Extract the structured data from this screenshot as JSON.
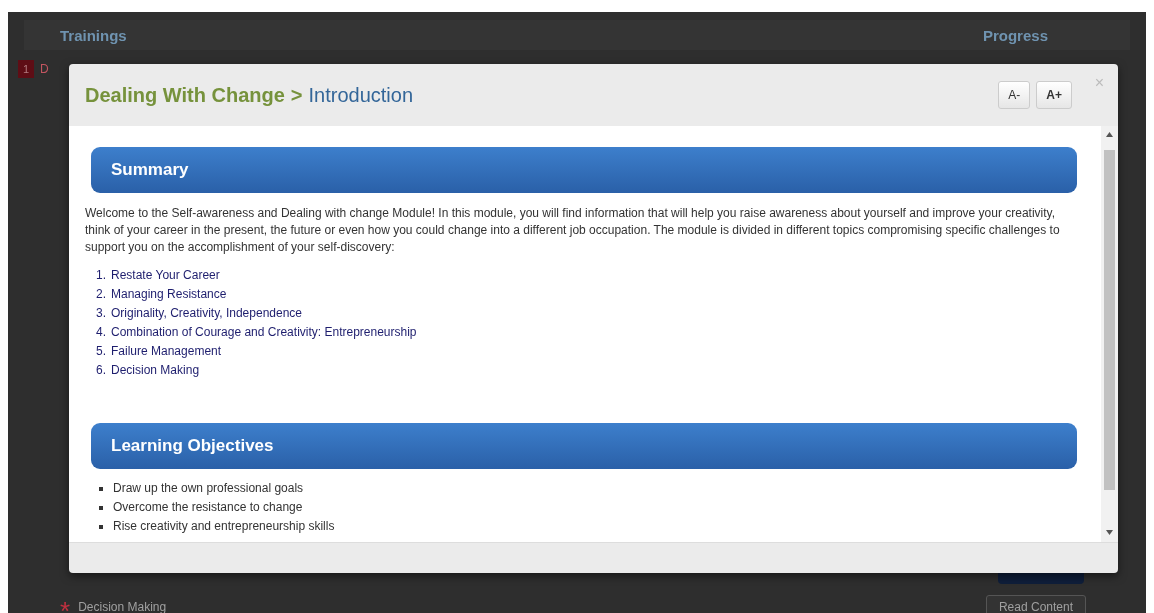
{
  "background_page": {
    "columns": [
      "Trainings",
      "Progress"
    ],
    "badge": "1",
    "first_row_text": "D",
    "last_row": {
      "marker": "*",
      "label": "Decision Making",
      "button": "Read Content"
    }
  },
  "modal": {
    "title": "Dealing With Change",
    "separator": ">",
    "subtitle": "Introduction",
    "font_buttons": [
      "A-",
      "A+"
    ],
    "close": "×",
    "sections": [
      {
        "heading": "Summary",
        "paragraph": "Welcome to the Self-awareness and Dealing with change Module! In this module, you will find information that will help you raise awareness about yourself and improve your creativity, think of your career in the present, the future or even how you could change into a different job occupation. The module is divided in different topics compromising specific challenges to support you on the accomplishment of your self-discovery:",
        "items": [
          {
            "number": "1.",
            "text": "Restate Your Career"
          },
          {
            "number": "2.",
            "text": "Managing Resistance"
          },
          {
            "number": "3.",
            "text": "Originality, Creativity, Independence"
          },
          {
            "number": "4.",
            "text": "Combination of Courage and Creativity: Entrepreneurship"
          },
          {
            "number": "5.",
            "text": "Failure Management"
          },
          {
            "number": "6.",
            "text": "Decision Making"
          }
        ]
      },
      {
        "heading": "Learning Objectives",
        "items": [
          {
            "text": "Draw up the own professional goals"
          },
          {
            "text": "Overcome the resistance to change"
          },
          {
            "text": "Rise creativity and entrepreneurship skills"
          }
        ]
      }
    ]
  }
}
